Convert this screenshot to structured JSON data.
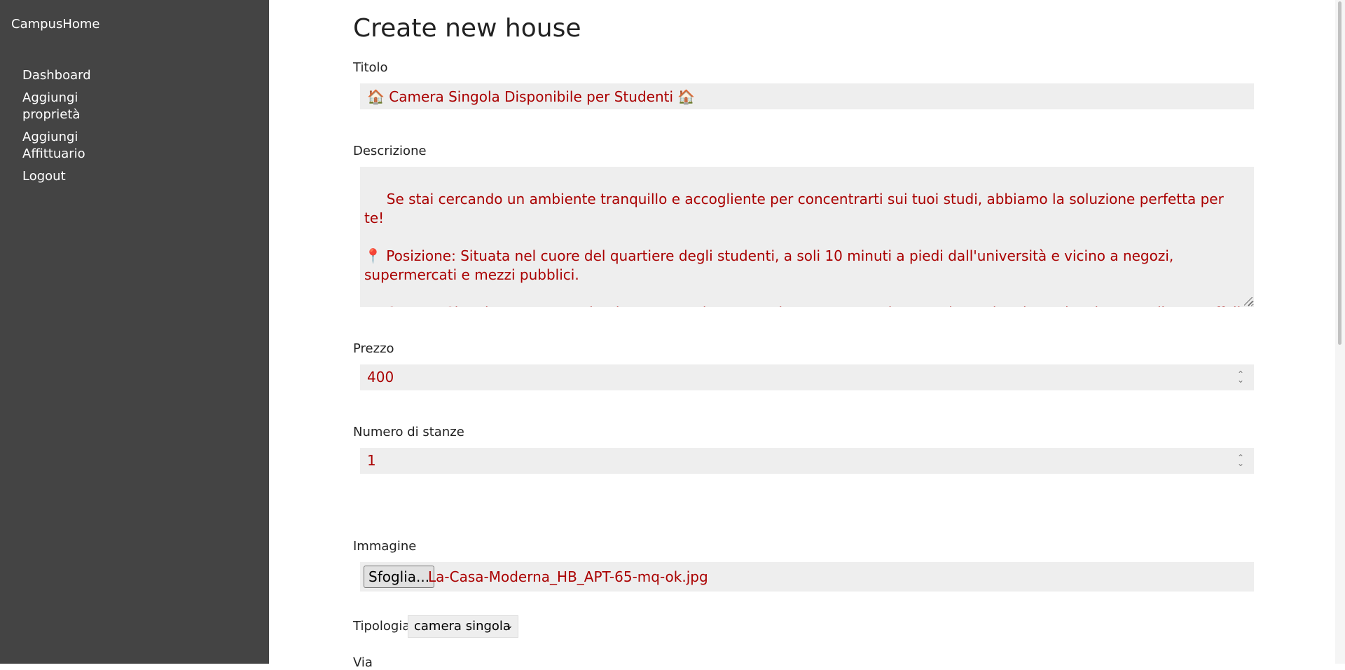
{
  "sidebar": {
    "brand": "CampusHome",
    "items": [
      {
        "label": "Dashboard"
      },
      {
        "label": "Aggiungi proprietà"
      },
      {
        "label": "Aggiungi Affittuario"
      },
      {
        "label": "Logout"
      }
    ]
  },
  "form": {
    "title": "Create new house",
    "titolo": {
      "label": "Titolo",
      "value": "🏠 Camera Singola Disponibile per Studenti 🏠"
    },
    "descrizione": {
      "label": "Descrizione",
      "value": " Se stai cercando un ambiente tranquillo e accogliente per concentrarti sui tuoi studi, abbiamo la soluzione perfetta per te!\n\n📍 Posizione: Situata nel cuore del quartiere degli studenti, a soli 10 minuti a piedi dall'università e vicino a negozi, supermercati e mezzi pubblici.\n\n🛏️ Camera Singola: Una stanza luminosa e spaziosa, completamente arredata con letto singolo, scrivania, armadio e scaffali per garantirti tutto il comfort di cui hai bisogno."
    },
    "prezzo": {
      "label": "Prezzo",
      "value": "400"
    },
    "stanze": {
      "label": "Numero di stanze",
      "value": "1"
    },
    "immagine": {
      "label": "Immagine",
      "button": "Sfoglia...",
      "filename": "La-Casa-Moderna_HB_APT-65-mq-ok.jpg"
    },
    "tipologia": {
      "label": "Tipologia",
      "selected": "camera singola"
    },
    "via": {
      "label": "Via"
    }
  }
}
